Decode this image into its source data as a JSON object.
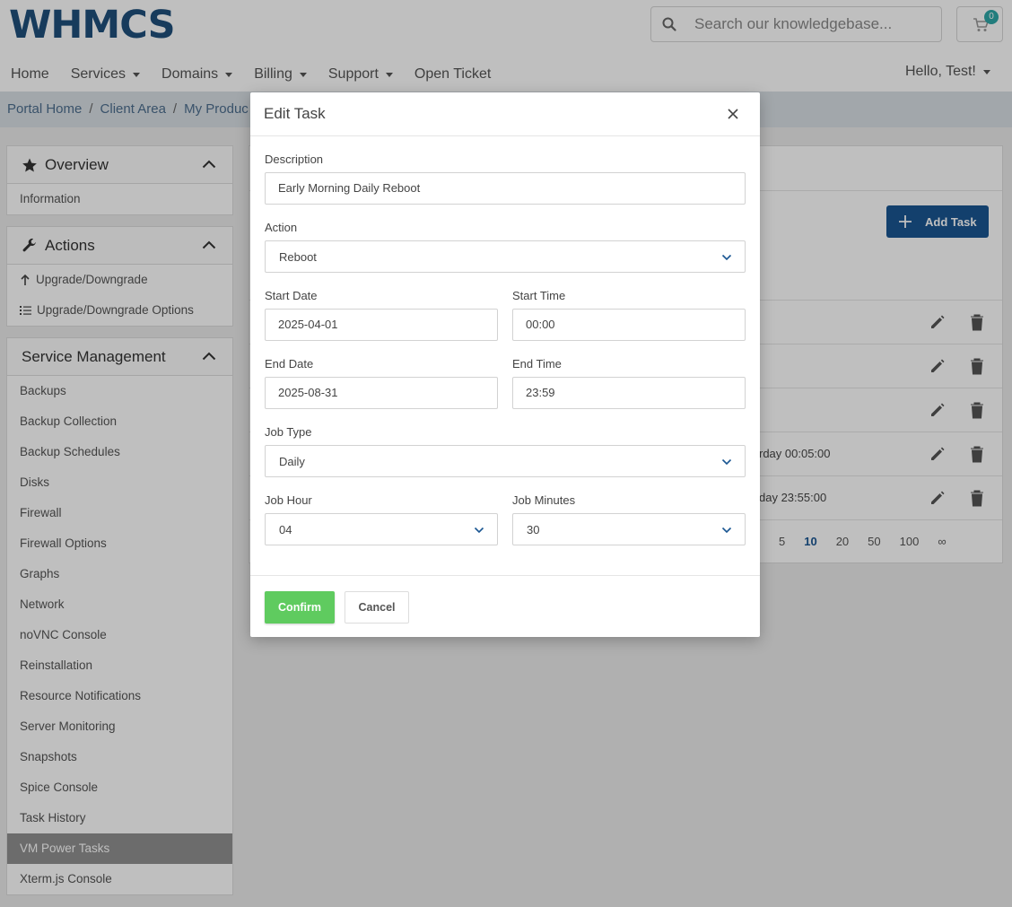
{
  "brand": {
    "logo_text": "WHMCS"
  },
  "search": {
    "placeholder": "Search our knowledgebase..."
  },
  "cart": {
    "count": "0"
  },
  "nav": {
    "items": [
      {
        "label": "Home",
        "dropdown": false
      },
      {
        "label": "Services",
        "dropdown": true
      },
      {
        "label": "Domains",
        "dropdown": true
      },
      {
        "label": "Billing",
        "dropdown": true
      },
      {
        "label": "Support",
        "dropdown": true
      },
      {
        "label": "Open Ticket",
        "dropdown": false
      }
    ],
    "user_label": "Hello, Test!"
  },
  "breadcrumb": [
    "Portal Home",
    "Client Area",
    "My Produc"
  ],
  "sidebar": {
    "overview": {
      "title": "Overview",
      "items": [
        "Information"
      ]
    },
    "actions": {
      "title": "Actions",
      "items": [
        "Upgrade/Downgrade",
        "Upgrade/Downgrade Options"
      ]
    },
    "service_management": {
      "title": "Service Management",
      "items": [
        "Backups",
        "Backup Collection",
        "Backup Schedules",
        "Disks",
        "Firewall",
        "Firewall Options",
        "Graphs",
        "Network",
        "noVNC Console",
        "Reinstallation",
        "Resource Notifications",
        "Server Monitoring",
        "Snapshots",
        "Spice Console",
        "Task History",
        "VM Power Tasks",
        "Xterm.js Console"
      ],
      "active": "VM Power Tasks"
    }
  },
  "main": {
    "add_task_label": "Add Task",
    "rows": [
      {
        "text": ""
      },
      {
        "text": ""
      },
      {
        "text": ""
      },
      {
        "text": "rday 00:05:00"
      },
      {
        "text": "day 23:55:00"
      }
    ],
    "pager": [
      "5",
      "10",
      "20",
      "50",
      "100",
      "∞"
    ],
    "pager_current": "10"
  },
  "modal": {
    "title": "Edit Task",
    "fields": {
      "description": {
        "label": "Description",
        "value": "Early Morning Daily Reboot"
      },
      "action": {
        "label": "Action",
        "value": "Reboot"
      },
      "start_date": {
        "label": "Start Date",
        "value": "2025-04-01"
      },
      "start_time": {
        "label": "Start Time",
        "value": "00:00"
      },
      "end_date": {
        "label": "End Date",
        "value": "2025-08-31"
      },
      "end_time": {
        "label": "End Time",
        "value": "23:59"
      },
      "job_type": {
        "label": "Job Type",
        "value": "Daily"
      },
      "job_hour": {
        "label": "Job Hour",
        "value": "04"
      },
      "job_minutes": {
        "label": "Job Minutes",
        "value": "30"
      }
    },
    "confirm_label": "Confirm",
    "cancel_label": "Cancel"
  },
  "colors": {
    "brand_blue": "#1f4f7b",
    "accent_green": "#5fcb5f",
    "primary_button": "#1a5692",
    "badge_teal": "#2ea7a7"
  }
}
